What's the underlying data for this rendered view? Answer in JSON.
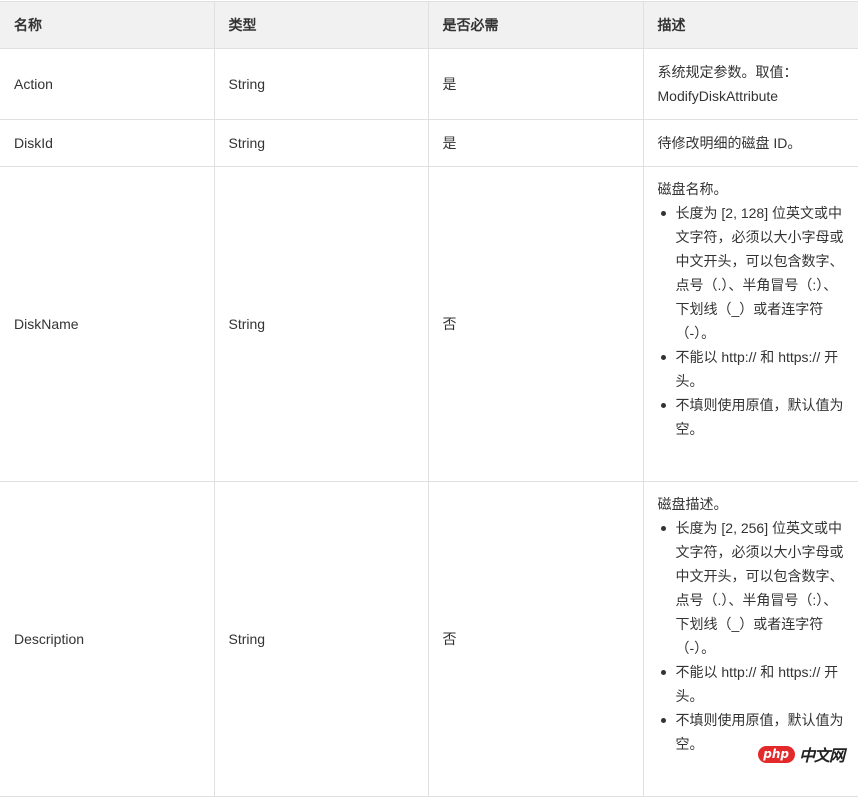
{
  "table": {
    "headers": [
      "名称",
      "类型",
      "是否必需",
      "描述"
    ],
    "rows": [
      {
        "name": "Action",
        "type": "String",
        "required": "是",
        "description_lines": [
          "系统规定参数。取值：",
          "ModifyDiskAttribute"
        ]
      },
      {
        "name": "DiskId",
        "type": "String",
        "required": "是",
        "description_lines": [
          "待修改明细的磁盘 ID。"
        ]
      },
      {
        "name": "DiskName",
        "type": "String",
        "required": "否",
        "description_lead": "磁盘名称。",
        "description_rules": [
          "长度为 [2, 128] 位英文或中文字符，必须以大小字母或中文开头，可以包含数字、点号（.）、半角冒号（:）、下划线（_）或者连字符（-）。",
          "不能以 http:// 和 https:// 开头。",
          "不填则使用原值，默认值为空。"
        ]
      },
      {
        "name": "Description",
        "type": "String",
        "required": "否",
        "description_lead": "磁盘描述。",
        "description_rules": [
          "长度为 [2, 256] 位英文或中文字符，必须以大小字母或中文开头，可以包含数字、点号（.）、半角冒号（:）、下划线（_）或者连字符（-）。",
          "不能以 http:// 和 https:// 开头。",
          "不填则使用原值，默认值为空。"
        ]
      }
    ]
  },
  "watermark": {
    "badge": "php",
    "text": "中文网",
    "badge_color": "#e4292a"
  }
}
